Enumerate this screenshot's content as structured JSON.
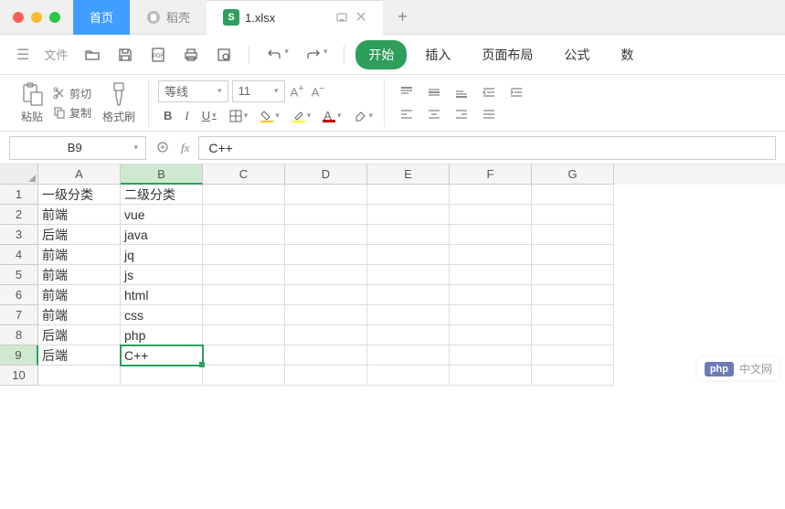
{
  "titlebar": {
    "home_tab": "首页",
    "dao_tab": "稻壳",
    "file_tab": "1.xlsx",
    "add": "+"
  },
  "menu": {
    "file": "文件",
    "items": [
      "开始",
      "插入",
      "页面布局",
      "公式",
      "数"
    ],
    "active_index": 0
  },
  "toolbar": {
    "paste": "粘贴",
    "cut": "剪切",
    "copy": "复制",
    "format_painter": "格式刷",
    "font_name": "等线",
    "font_size": "11"
  },
  "formula": {
    "cell_ref": "B9",
    "fx": "fx",
    "value": "C++"
  },
  "grid": {
    "columns": [
      "A",
      "B",
      "C",
      "D",
      "E",
      "F",
      "G"
    ],
    "selected_col": "B",
    "selected_row": 9,
    "rows": [
      {
        "n": 1,
        "A": "一级分类",
        "B": "二级分类"
      },
      {
        "n": 2,
        "A": "前端",
        "B": "vue"
      },
      {
        "n": 3,
        "A": "后端",
        "B": "java"
      },
      {
        "n": 4,
        "A": "前端",
        "B": "jq"
      },
      {
        "n": 5,
        "A": "前端",
        "B": "js"
      },
      {
        "n": 6,
        "A": "前端",
        "B": "html"
      },
      {
        "n": 7,
        "A": "前端",
        "B": "css"
      },
      {
        "n": 8,
        "A": "后端",
        "B": "php"
      },
      {
        "n": 9,
        "A": "后端",
        "B": "C++"
      },
      {
        "n": 10,
        "A": "",
        "B": ""
      }
    ]
  },
  "watermark": {
    "badge": "php",
    "text": "中文网"
  }
}
